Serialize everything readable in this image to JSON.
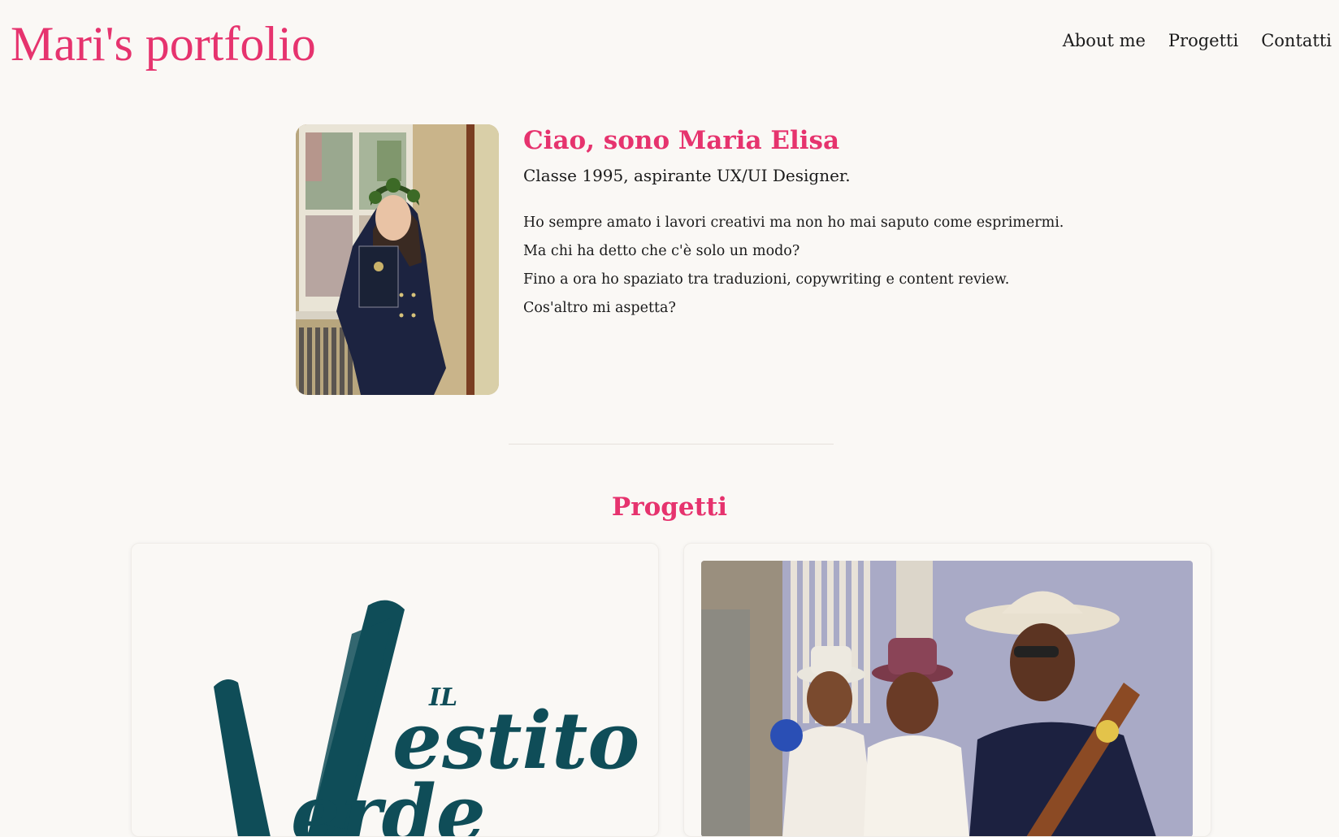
{
  "header": {
    "brand": "Mari's portfolio",
    "nav": [
      {
        "label": "About me"
      },
      {
        "label": "Progetti"
      },
      {
        "label": "Contatti"
      }
    ]
  },
  "about": {
    "greeting": "Ciao, sono Maria Elisa",
    "subtitle": "Classe 1995, aspirante UX/UI Designer.",
    "bio": [
      "Ho sempre amato i lavori creativi ma non ho mai saputo come esprimermi.",
      "Ma chi ha detto che c'è solo un modo?",
      "Fino a ora ho spaziato tra traduzioni, copywriting e content review.",
      "Cos'altro mi aspetta?"
    ]
  },
  "projects": {
    "title": "Progetti",
    "cards": [
      {
        "logo_text": "Il Vestito Verde"
      },
      {
        "image_desc": "musicians-photo"
      }
    ]
  },
  "colors": {
    "accent": "#e6336e",
    "background": "#faf8f5",
    "logo_green": "#0f4d58"
  }
}
